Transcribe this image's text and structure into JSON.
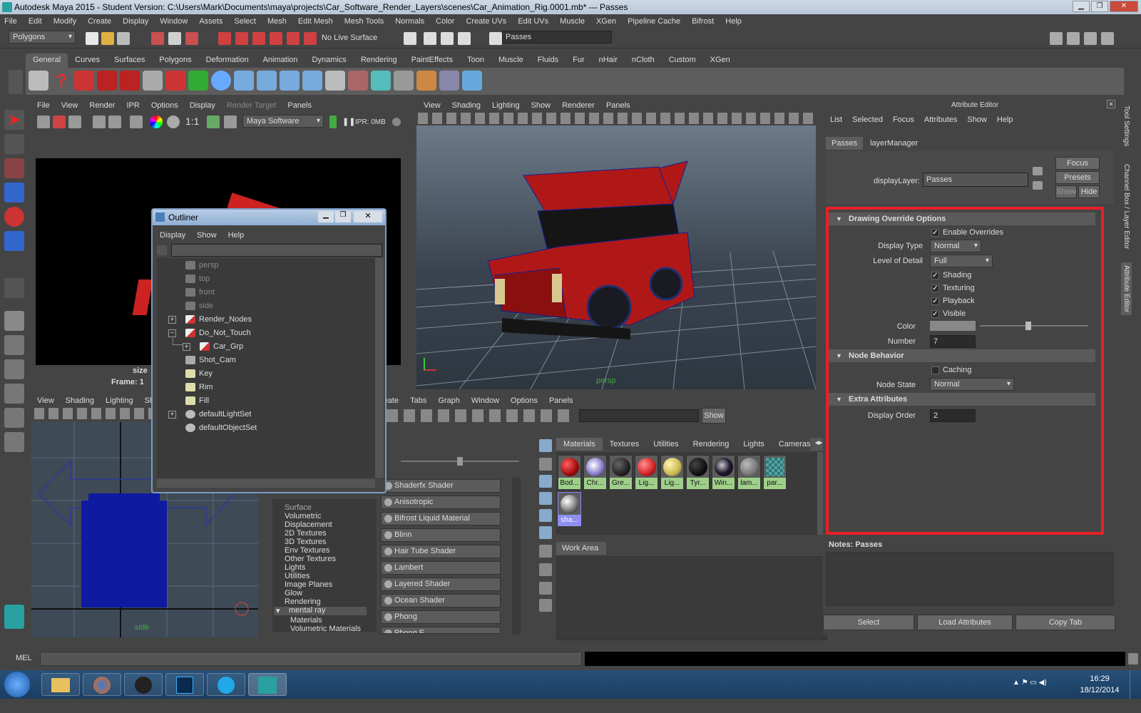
{
  "window": {
    "title": "Autodesk Maya 2015 - Student Version: C:\\Users\\Mark\\Documents\\maya\\projects\\Car_Software_Render_Layers\\scenes\\Car_Animation_Rig.0001.mb*   ---   Passes"
  },
  "menubar": [
    "File",
    "Edit",
    "Modify",
    "Create",
    "Display",
    "Window",
    "Assets",
    "Select",
    "Mesh",
    "Edit Mesh",
    "Mesh Tools",
    "Normals",
    "Color",
    "Create UVs",
    "Edit UVs",
    "Muscle",
    "XGen",
    "Pipeline Cache",
    "Bifrost",
    "Help"
  ],
  "status": {
    "mode": "Polygons",
    "live_surface": "No Live Surface",
    "layer_field": "Passes"
  },
  "shelf_tabs": [
    "General",
    "Curves",
    "Surfaces",
    "Polygons",
    "Deformation",
    "Animation",
    "Dynamics",
    "Rendering",
    "PaintEffects",
    "Toon",
    "Muscle",
    "Fluids",
    "Fur",
    "nHair",
    "nCloth",
    "Custom",
    "XGen"
  ],
  "render_view": {
    "menu": [
      "File",
      "View",
      "Render",
      "IPR",
      "Options",
      "Display",
      "Render Target",
      "Panels"
    ],
    "renderer": "Maya Software",
    "ratio": "1:1",
    "ipr": "IPR: 0MB",
    "size_label": "size",
    "frame_label": "Frame: 1"
  },
  "persp_view": {
    "menu": [
      "View",
      "Shading",
      "Lighting",
      "Show",
      "Renderer",
      "Panels"
    ],
    "camera": "persp"
  },
  "side_view": {
    "menu": [
      "View",
      "Shading",
      "Lighting",
      "Show"
    ],
    "camera": "side"
  },
  "outliner": {
    "title": "Outliner",
    "menu": [
      "Display",
      "Show",
      "Help"
    ],
    "items": [
      {
        "label": "persp",
        "dim": true
      },
      {
        "label": "top",
        "dim": true
      },
      {
        "label": "front",
        "dim": true
      },
      {
        "label": "side",
        "dim": true
      },
      {
        "label": "Render_Nodes",
        "dim": false
      },
      {
        "label": "Do_Not_Touch",
        "dim": false
      },
      {
        "label": "Car_Grp",
        "dim": false
      },
      {
        "label": "Shot_Cam",
        "dim": false
      },
      {
        "label": "Key",
        "dim": false
      },
      {
        "label": "Rim",
        "dim": false
      },
      {
        "label": "Fill",
        "dim": false
      },
      {
        "label": "defaultLightSet",
        "dim": false
      },
      {
        "label": "defaultObjectSet",
        "dim": false
      }
    ]
  },
  "hypershade": {
    "menu": [
      "reate",
      "Tabs",
      "Graph",
      "Window",
      "Options",
      "Panels"
    ],
    "show_btn": "Show",
    "tabs": [
      "Materials",
      "Textures",
      "Utilities",
      "Rendering",
      "Lights",
      "Cameras"
    ],
    "materials": [
      {
        "name": "Bod...",
        "color": "#a00c0c"
      },
      {
        "name": "Chr...",
        "color": "#c9c9ff"
      },
      {
        "name": "Gre...",
        "color": "#333333"
      },
      {
        "name": "Lig...",
        "color": "#e03030"
      },
      {
        "name": "Lig...",
        "color": "#d6c860"
      },
      {
        "name": "Tyr...",
        "color": "#1a1a1a"
      },
      {
        "name": "Win...",
        "color": "#221a30"
      },
      {
        "name": "lam...",
        "color": "#8a8a8a"
      },
      {
        "name": "par...",
        "color": "#3a8a8a"
      },
      {
        "name": "sha...",
        "color": "#cccccc"
      }
    ],
    "work_area": "Work Area",
    "categories": [
      "Surface",
      "Volumetric",
      "Displacement",
      "2D Textures",
      "3D Textures",
      "Env Textures",
      "Other Textures",
      "Lights",
      "Utilities",
      "Image Planes",
      "Glow",
      "Rendering",
      "mental ray",
      "Materials",
      "Volumetric Materials"
    ],
    "shaders": [
      "Shaderfx Shader",
      "Anisotropic",
      "Bifrost Liquid Material",
      "Blinn",
      "Hair Tube Shader",
      "Lambert",
      "Layered Shader",
      "Ocean Shader",
      "Phong",
      "Phong E"
    ]
  },
  "attr_editor": {
    "title": "Attribute Editor",
    "menu": [
      "List",
      "Selected",
      "Focus",
      "Attributes",
      "Show",
      "Help"
    ],
    "tabs": [
      "Passes",
      "layerManager"
    ],
    "display_layer_label": "displayLayer:",
    "display_layer_value": "Passes",
    "focus_btn": "Focus",
    "presets_btn": "Presets",
    "show_btn": "Show",
    "hide_btn": "Hide",
    "drawing_override": "Drawing Override Options",
    "enable_overrides": "Enable Overrides",
    "display_type_label": "Display Type",
    "display_type": "Normal",
    "lod_label": "Level of Detail",
    "lod": "Full",
    "shading": "Shading",
    "texturing": "Texturing",
    "playback": "Playback",
    "visible": "Visible",
    "color_label": "Color",
    "color_level": 0.45,
    "number_label": "Number",
    "number": "7",
    "node_behavior": "Node Behavior",
    "caching": "Caching",
    "node_state_label": "Node State",
    "node_state": "Normal",
    "extra_attributes": "Extra Attributes",
    "display_order_label": "Display Order",
    "display_order": "2",
    "notes": "Notes:  Passes",
    "select_btn": "Select",
    "load_btn": "Load Attributes",
    "copy_btn": "Copy Tab",
    "highlight_color": "#e8202a"
  },
  "side_tabs": [
    "Tool Settings",
    "Channel Box / Layer Editor",
    "Attribute Editor"
  ],
  "command": {
    "mel": "MEL"
  },
  "taskbar": {
    "time": "16:29",
    "date": "18/12/2014"
  }
}
